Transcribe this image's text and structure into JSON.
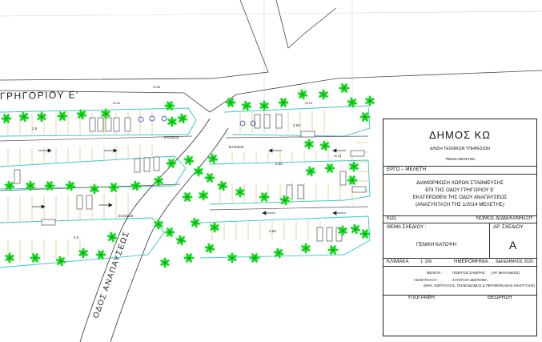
{
  "road_labels": {
    "grigoriou": "ΓΡΗΓΟΡΙΟΥ Ε'",
    "anapafseos": "ΟΔΟΣ ΑΝΑΠΑΥΣΕΩΣ"
  },
  "plan_labels": {
    "exodos_1": "ΕΞΟΔΟΣ",
    "exodos_2": "ΕΞΟΔΟΣ",
    "exodos_3": "ΕΞΟΔΟΣ",
    "level_1": "+8.65",
    "level_2": "+8.15",
    "level_3": "+8.15",
    "level_4": "+8.15",
    "width_1": "2.5",
    "width_2": "2.50",
    "width_3": "2.50",
    "width_4": "2.50",
    "width_5": "2.5"
  },
  "title_block": {
    "municipality": "ΔΗΜΟΣ ΚΩ",
    "directorate": "Δ/ΝΣΗ ΤΕΧΝΙΚΩΝ ΥΠΗΡΕΣΙΩΝ",
    "department": "ΤΜΗΜΑ ΜΕΛΕΤΩΝ",
    "project_label": "ΕΡΓΟ – ΜΕΛΕΤΗ",
    "project_line1": "ΔΙΑΜΟΡΦΩΣΗ ΧΩΡΩΝ ΣΤΑΘΜΕΥΣΗΣ",
    "project_line2": "ΕΠΙ ΤΗΣ ΟΔΟΥ ΓΡΗΓΟΡΙΟΥ Ε'",
    "project_line3": "ΕΚΑΤΕΡΩΘΕΝ ΤΗΣ ΟΔΟΥ ΑΝΑΠΑΥΣΕΩΣ",
    "project_line4": "(ΑΝΑΣΥΝΤΑΞΗ ΤΗΣ 1/2014 ΜΕΛΕΤΗΣ)",
    "place": "ΚΩΣ",
    "prefecture": "ΝΟΜΟΣ ΔΩΔΕΚΑΝΗΣΟΥ",
    "drawing_subject_label": "ΘΕΜΑ ΣΧΕΔΙΟΥ :",
    "drawing_number_label": "ΑΡ. ΣΧΕΔΙΟΥ",
    "drawing_subject": "ΓΕΝΙΚΗ ΚΑΤΟΨΗ",
    "drawing_number": "Α",
    "scale_label": "ΚΛΙΜΑΚΑ",
    "scale_value": "1: 200",
    "date_label": "ΗΜΕΡΟΜΗΝΙΑ",
    "date_value": "ΔΕΚΕΜΒΡΙΟΣ 2020",
    "study_label": "ΜΕΛΕΤΗ :",
    "study_name": "ΓΕΩΡΓΙΟΣ ΣΑΚΕΡΗΣ",
    "study_role": "(ΑΡ. ΜΗΧΑΝΙΚΟΣ)",
    "revision_label": "ΑΝΑΣΥΝΤΑΞΗ :",
    "revision_name": "ΣΑΤΟΓΛΟΥ ΔΕΣΠΟΙΝΑ",
    "revision_role": "(ΜΗΧ. ΧΩΡΟΤΑΞΙΑΣ, ΠΟΛΕΟΔΟΜΙΑΣ & ΠΕΡΙΦΕΡΕΙΑΚΗΣ ΑΝΑΠΤΥΞΗΣ)",
    "signature_label": "ΥΠΟΓΡΑΦΗ",
    "approval_label": "ΘΕΩΡΗΣΗ"
  },
  "colors": {
    "tree": "#14d61e",
    "island": "#33c6c6",
    "stall": "#d9c27a",
    "line": "#333333",
    "grid": "#cfcfcf"
  }
}
